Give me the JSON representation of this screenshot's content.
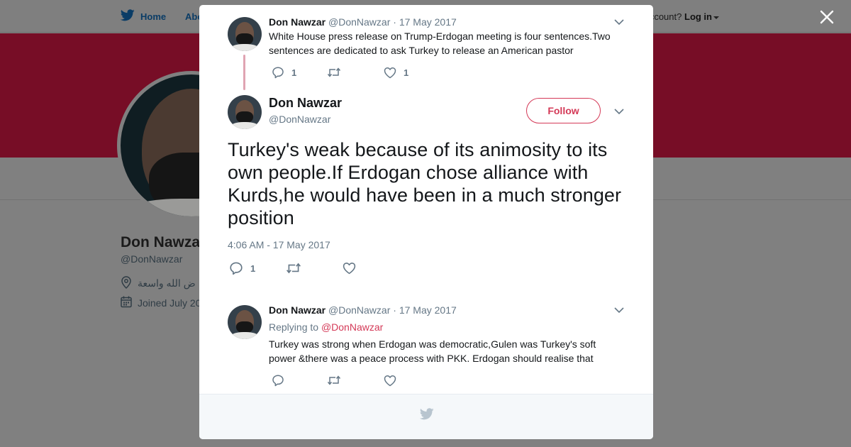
{
  "background": {
    "nav": {
      "home": "Home",
      "about": "Abo",
      "account_prompt": "ccount?",
      "login": "Log in"
    },
    "profile": {
      "name": "Don Nawza",
      "handle": "@DonNawzar",
      "location": "ض الله واسعة",
      "joined": "Joined July 20"
    }
  },
  "modal": {
    "parent_tweet": {
      "name": "Don Nawzar",
      "handle": "@DonNawzar",
      "date": "· 17 May 2017",
      "text": "White House press release on Trump-Erdogan meeting is four sentences.Two sentences are dedicated to ask Turkey to release an American pastor",
      "reply_count": "1",
      "like_count": "1"
    },
    "main_tweet": {
      "name": "Don Nawzar",
      "handle": "@DonNawzar",
      "follow_label": "Follow",
      "text": "Turkey's weak because of its animosity to its own people.If Erdogan chose alliance with Kurds,he would have been in a much stronger position",
      "timestamp": "4:06 AM - 17 May 2017",
      "reply_count": "1"
    },
    "reply_tweet": {
      "name": "Don Nawzar",
      "handle": "@DonNawzar",
      "date": "· 17 May 2017",
      "replying_label": "Replying to",
      "replying_to": "@DonNawzar",
      "text": "Turkey was strong when Erdogan was democratic,Gulen was Turkey's soft power &there was a peace process with PKK. Erdogan should realise that"
    }
  },
  "colors": {
    "accent": "#d43957",
    "banner": "#770d26",
    "muted": "#657786"
  }
}
